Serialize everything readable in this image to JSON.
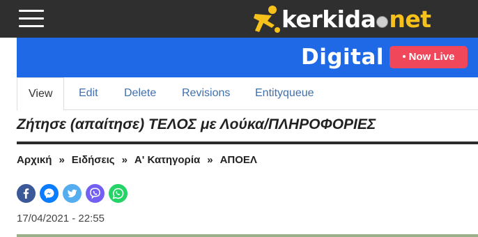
{
  "header": {
    "menu_icon": "hamburger-menu-icon",
    "logo": {
      "brand": "kerkida",
      "tld": "net",
      "icon": "soccer-player-logo-icon",
      "ball_icon": "soccer-ball-icon"
    }
  },
  "banner": {
    "label": "Digital",
    "live_button": "Now Live",
    "background": "#1f69e6",
    "live_color": "#f0475a"
  },
  "tabs": [
    {
      "label": "View",
      "active": true
    },
    {
      "label": "Edit",
      "active": false
    },
    {
      "label": "Delete",
      "active": false
    },
    {
      "label": "Revisions",
      "active": false
    },
    {
      "label": "Entityqueue",
      "active": false
    }
  ],
  "article": {
    "title": "Ζήτησε (απαίτησε) ΤΕΛΟΣ με Λούκα/ΠΛΗΡΟΦΟΡΙΕΣ",
    "date": "17/04/2021 - 22:55"
  },
  "breadcrumb": {
    "separator": "»",
    "items": [
      "Αρχική",
      "Ειδήσεις",
      "Α' Κατηγορία",
      "ΑΠΟΕΛ"
    ]
  },
  "share": [
    {
      "icon": "facebook-icon",
      "color": "#3b5998"
    },
    {
      "icon": "messenger-icon",
      "color": "#0a7cff"
    },
    {
      "icon": "twitter-icon",
      "color": "#55acee"
    },
    {
      "icon": "viber-icon",
      "color": "#7360f2"
    },
    {
      "icon": "whatsapp-icon",
      "color": "#25d366"
    }
  ]
}
